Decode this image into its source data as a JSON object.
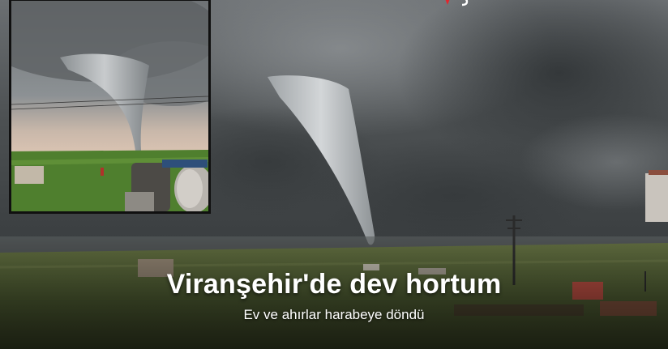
{
  "news_card": {
    "headline": "Viranşehir'de dev hortum",
    "subheadline": "Ev ve ahırlar harabeye döndü"
  },
  "images": {
    "main_photo": "tornado-over-field",
    "inset_photo": "tornado-closeup-with-water-tanks"
  },
  "colors": {
    "brand_red": "#e3262e",
    "headline_text": "#ffffff",
    "inset_border": "#101010"
  }
}
